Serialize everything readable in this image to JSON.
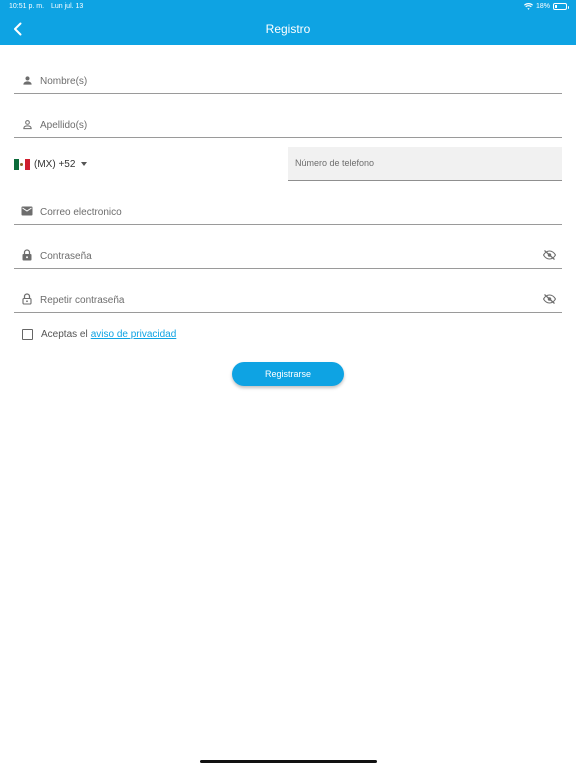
{
  "status_bar": {
    "time": "10:51 p. m.",
    "date": "Lun jul. 13",
    "battery": "18%",
    "battery_level": 0.18
  },
  "header": {
    "title": "Registro",
    "back_icon": "chevron-left-icon",
    "color": "#0ea3e3"
  },
  "form": {
    "first_name": {
      "placeholder": "Nombre(s)",
      "icon": "person-icon"
    },
    "last_name": {
      "placeholder": "Apellido(s)",
      "icon": "person-outline-icon"
    },
    "phone": {
      "country_code": "(MX) +52",
      "country_flag": "mexico-flag-icon",
      "placeholder": "Número de telefono"
    },
    "email": {
      "placeholder": "Correo electronico",
      "icon": "mail-icon"
    },
    "password": {
      "placeholder": "Contraseña",
      "icon": "lock-icon",
      "toggle_icon": "eye-off-icon"
    },
    "repeat_password": {
      "placeholder": "Repetir contraseña",
      "icon": "lock-outline-icon",
      "toggle_icon": "eye-off-icon"
    }
  },
  "privacy": {
    "text": "Aceptas el",
    "link": "aviso de privacidad",
    "checked": false
  },
  "submit": {
    "label": "Registrarse"
  },
  "colors": {
    "accent": "#0ea3e3",
    "divider": "#9a9a9a",
    "placeholder": "#6d6d6d"
  }
}
